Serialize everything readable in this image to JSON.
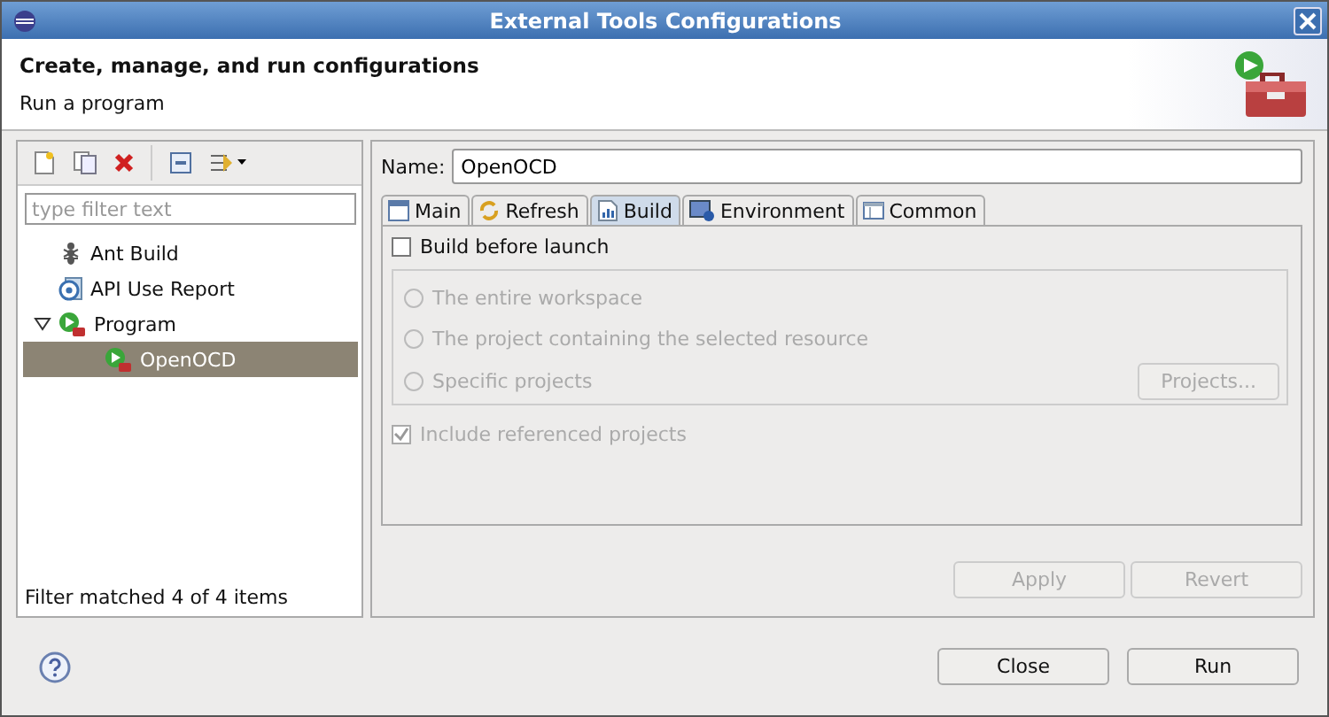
{
  "window": {
    "title": "External Tools Configurations"
  },
  "header": {
    "title": "Create, manage, and run configurations",
    "subtitle": "Run a program"
  },
  "sidebar": {
    "filter": {
      "placeholder": "type filter text"
    },
    "tree": [
      {
        "label": "Ant Build",
        "kind": "ant",
        "selected": false
      },
      {
        "label": "API Use Report",
        "kind": "api",
        "selected": false
      },
      {
        "label": "Program",
        "kind": "program",
        "selected": false,
        "expanded": true,
        "children": [
          {
            "label": "OpenOCD",
            "kind": "program",
            "selected": true
          }
        ]
      }
    ],
    "status": "Filter matched 4 of 4 items"
  },
  "editor": {
    "name_label": "Name:",
    "name_value": "OpenOCD",
    "tabs": [
      {
        "label": "Main",
        "kind": "main",
        "selected": false
      },
      {
        "label": "Refresh",
        "kind": "refresh",
        "selected": false
      },
      {
        "label": "Build",
        "kind": "build",
        "selected": true
      },
      {
        "label": "Environment",
        "kind": "environment",
        "selected": false
      },
      {
        "label": "Common",
        "kind": "common",
        "selected": false
      }
    ],
    "build_before_launch": {
      "label": "Build before launch",
      "checked": false
    },
    "scope_options": [
      {
        "label": "The entire workspace",
        "selected": false,
        "disabled": true
      },
      {
        "label": "The project containing the selected resource",
        "selected": false,
        "disabled": true
      },
      {
        "label": "Specific projects",
        "selected": false,
        "disabled": true
      }
    ],
    "projects_button": {
      "label": "Projects...",
      "disabled": true
    },
    "include_referenced": {
      "label": "Include referenced projects",
      "checked": true,
      "disabled": true
    },
    "buttons": [
      {
        "label": "Apply",
        "disabled": true
      },
      {
        "label": "Revert",
        "disabled": true
      }
    ]
  },
  "footer_buttons": [
    {
      "label": "Close",
      "disabled": false
    },
    {
      "label": "Run",
      "disabled": false
    }
  ]
}
